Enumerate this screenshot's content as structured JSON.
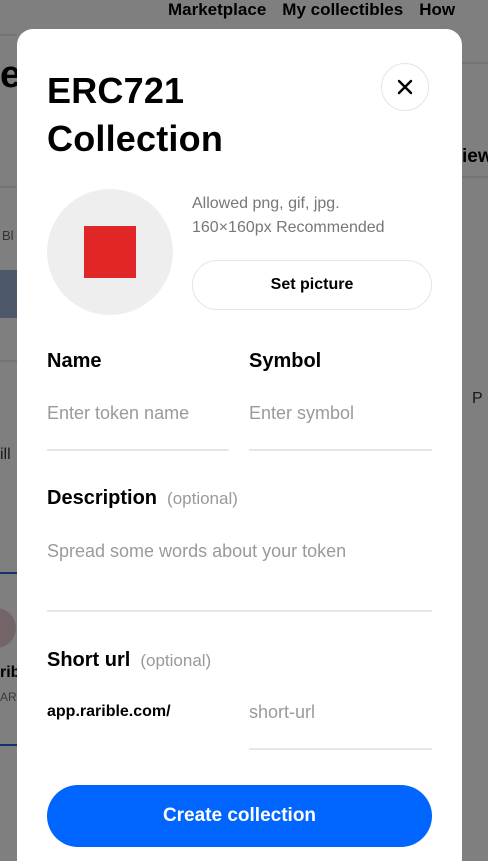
{
  "background": {
    "nav": [
      "Marketplace",
      "My collectibles",
      "How"
    ],
    "fragments": {
      "left_letter": "e",
      "right_view": "iew",
      "left_b": "Bl",
      "left_ill": "ill",
      "right_p": "P",
      "left_rib": "rib",
      "left_ar": "AR"
    }
  },
  "modal": {
    "title_line1": "ERC721",
    "title_line2": "Collection",
    "close_icon": "close-icon",
    "picture": {
      "hint_line1": "Allowed png, gif, jpg.",
      "hint_line2": "160×160px Recommended",
      "button_label": "Set picture",
      "preview_color": "#e02626"
    },
    "name": {
      "label": "Name",
      "placeholder": "Enter token name"
    },
    "symbol": {
      "label": "Symbol",
      "placeholder": "Enter symbol"
    },
    "description": {
      "label": "Description",
      "optional": "(optional)",
      "placeholder": "Spread some words about your token"
    },
    "short_url": {
      "label": "Short url",
      "optional": "(optional)",
      "prefix": "app.rarible.com/",
      "placeholder": "short-url"
    },
    "create_button": "Create collection",
    "accent_color": "#0066ff"
  }
}
